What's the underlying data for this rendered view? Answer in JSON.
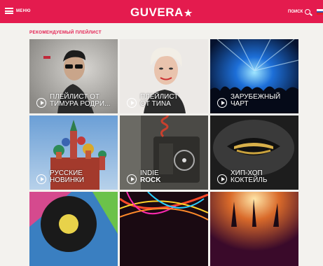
{
  "header": {
    "menu_label": "МЕНЮ",
    "logo_text": "GUVERA",
    "logo_star": "★",
    "search_label": "ПОИСК",
    "accent_color": "#e41b4e"
  },
  "section": {
    "title": "РЕКОМЕНДУЕМЫЙ ПЛЕЙЛИСТ"
  },
  "tiles": [
    {
      "line1": "ПЛЕЙЛИСТ ОТ",
      "line2": "ТИМУРА РОДРИ..."
    },
    {
      "line1": "ПЛЕЙЛИСТ",
      "line2": "ОТ TИNA"
    },
    {
      "line1": "ЗАРУБЕЖНЫЙ",
      "line2": "ЧАРТ"
    },
    {
      "line1": "РУССКИЕ",
      "line2": "НОВИНКИ"
    },
    {
      "line1": "INDIE",
      "line2": "ROCK"
    },
    {
      "line1": "ХИП-ХОП",
      "line2": "КОКТЕЙЛЬ"
    },
    {
      "line1": "",
      "line2": ""
    },
    {
      "line1": "",
      "line2": ""
    },
    {
      "line1": "",
      "line2": ""
    }
  ]
}
